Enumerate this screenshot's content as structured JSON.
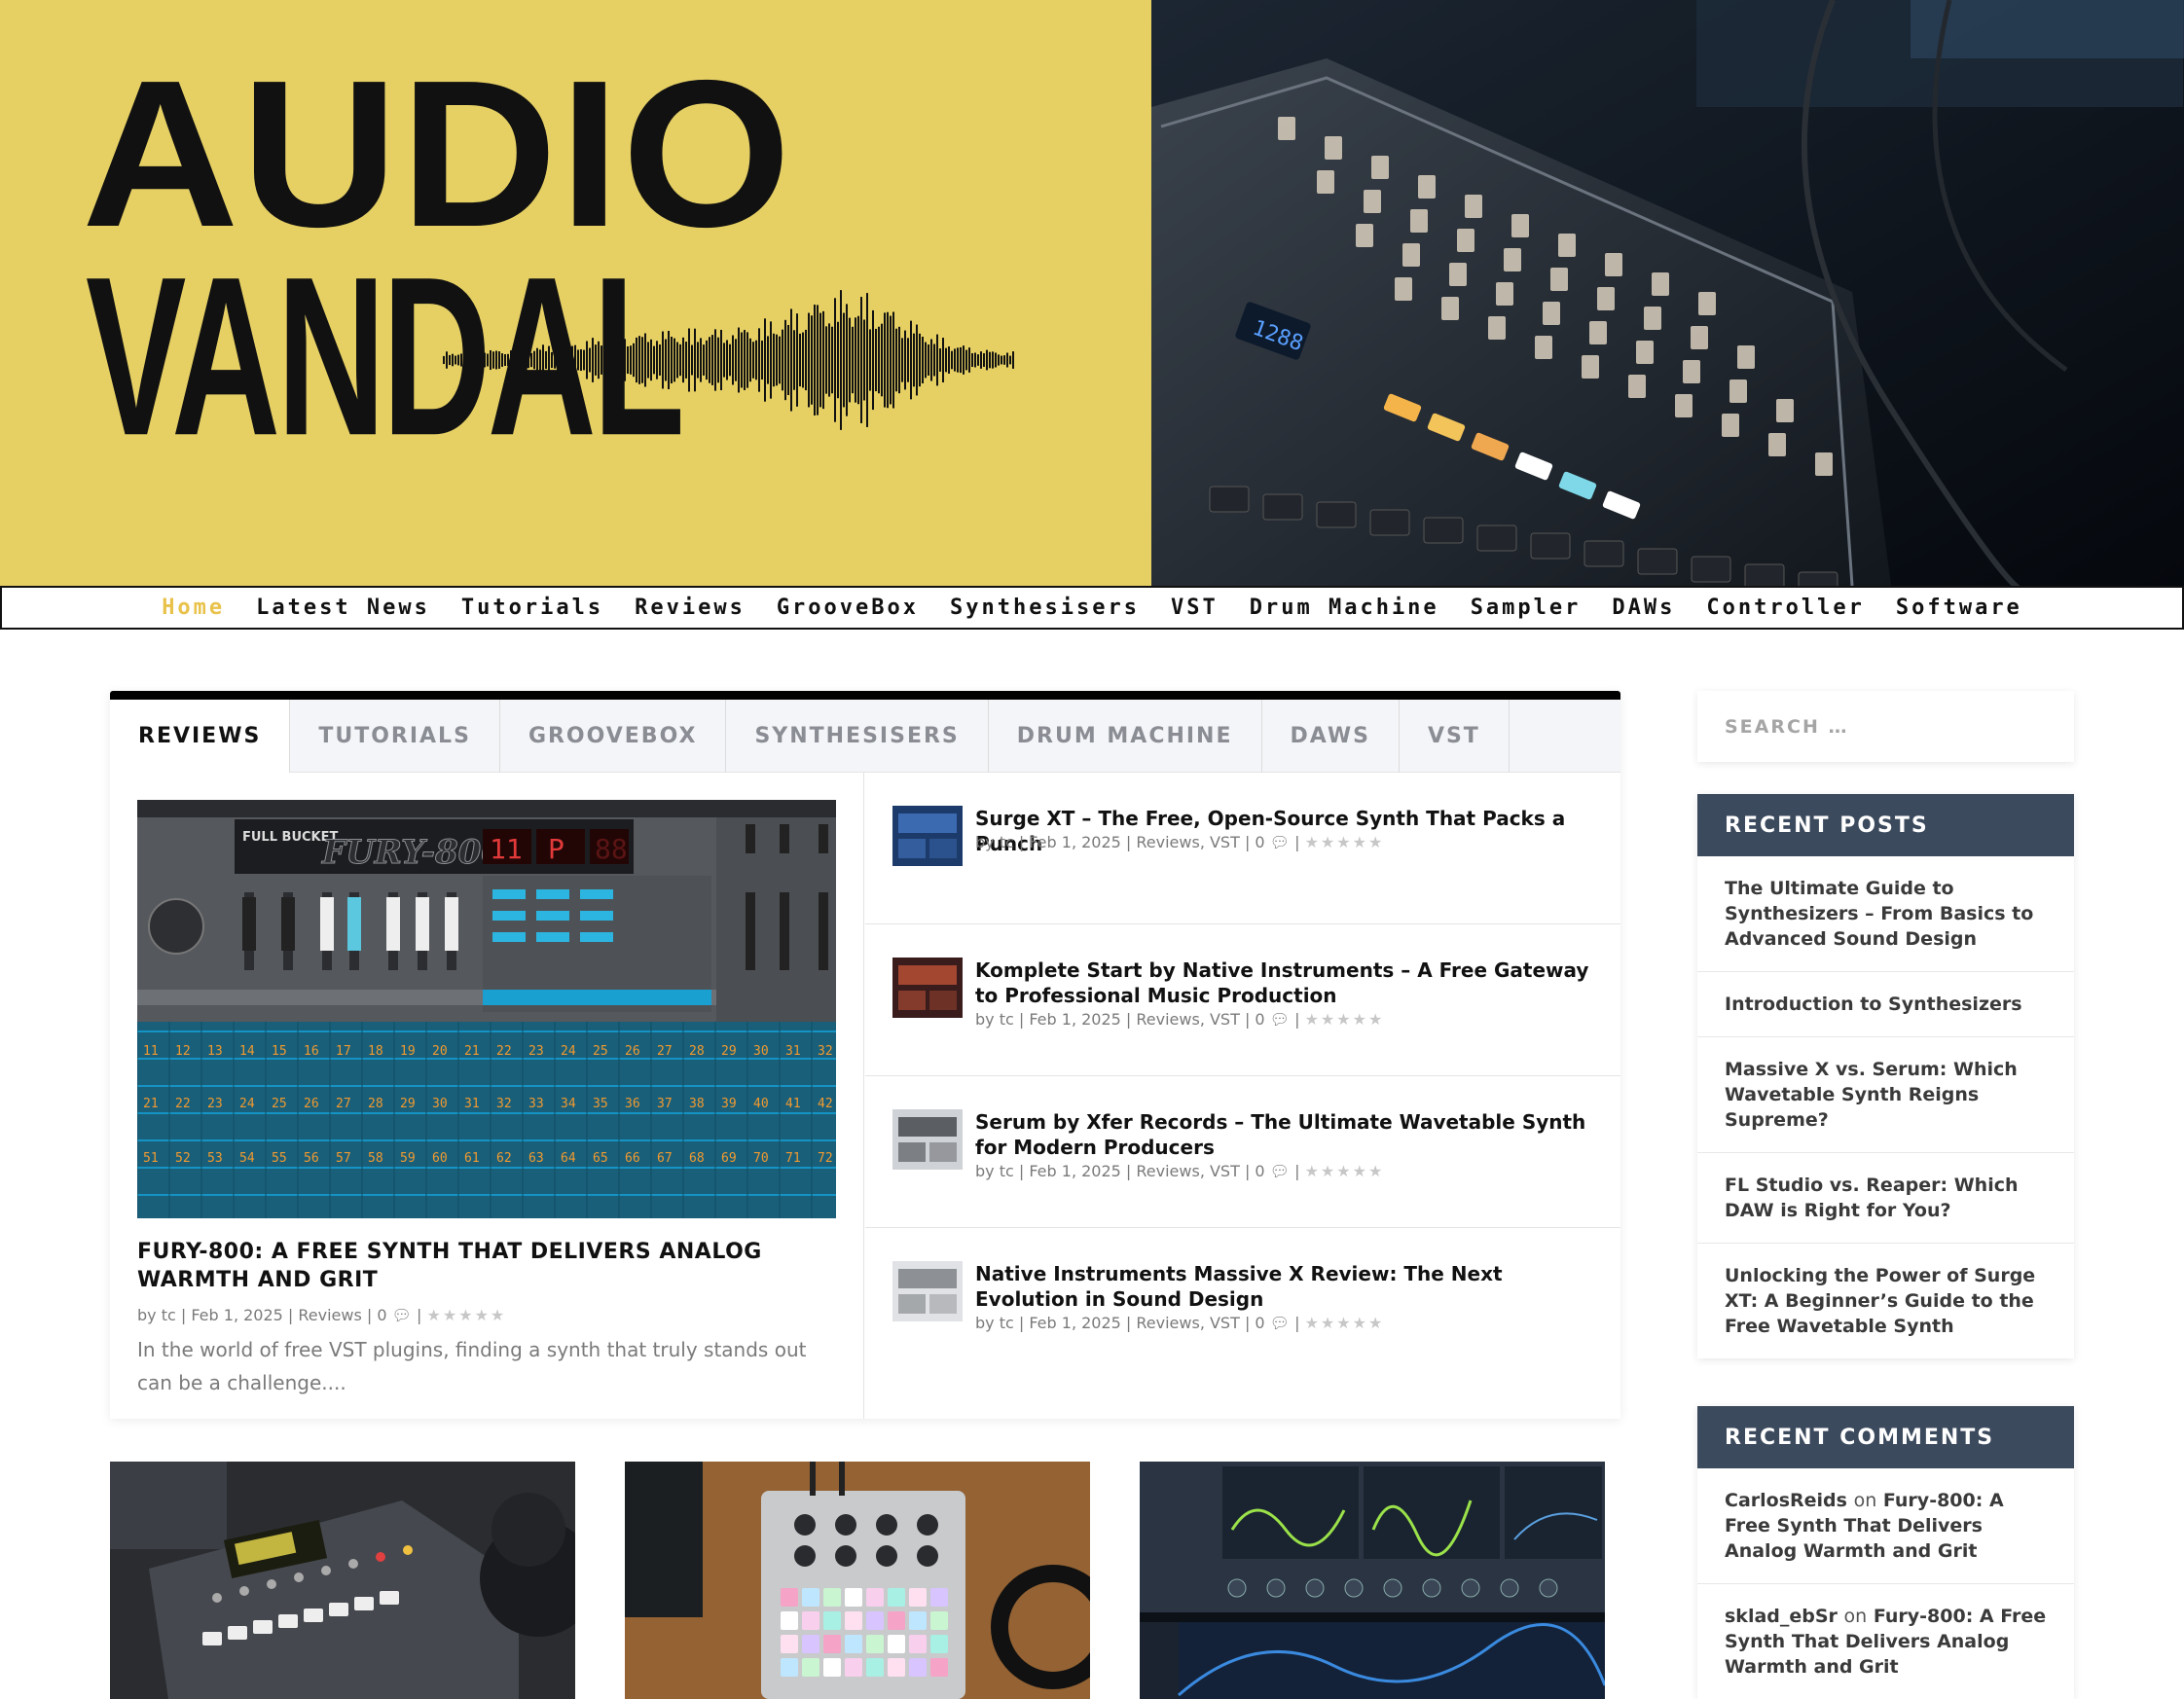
{
  "logo": {
    "line1": "AUDIO",
    "line2": "VANDAL"
  },
  "nav": {
    "items": [
      {
        "label": "Home",
        "active": true
      },
      {
        "label": "Latest News"
      },
      {
        "label": "Tutorials"
      },
      {
        "label": "Reviews"
      },
      {
        "label": "GrooveBox"
      },
      {
        "label": "Synthesisers"
      },
      {
        "label": "VST"
      },
      {
        "label": "Drum Machine"
      },
      {
        "label": "Sampler"
      },
      {
        "label": "DAWs"
      },
      {
        "label": "Controller"
      },
      {
        "label": "Software"
      }
    ]
  },
  "tabs": [
    "REVIEWS",
    "TUTORIALS",
    "GROOVEBOX",
    "SYNTHESISERS",
    "DRUM MACHINE",
    "DAWS",
    "VST"
  ],
  "feature": {
    "image_text": {
      "brand": "FULL BUCKET",
      "model": "FURY-800",
      "display1": "11",
      "display2": "P",
      "display3": "88"
    },
    "title": "FURY-800: A FREE SYNTH THAT DELIVERS ANALOG WARMTH AND GRIT",
    "meta": "by tc | Feb 1, 2025 | Reviews | 0",
    "stars": "★★★★★",
    "excerpt": "In the world of free VST plugins, finding a synth that truly stands out can be a challenge...."
  },
  "posts": [
    {
      "title": "Surge XT – The Free, Open-Source Synth That Packs a Punch",
      "meta": "by tc | Feb 1, 2025 | Reviews, VST | 0",
      "stars": "★★★★★"
    },
    {
      "title": "Komplete Start by Native Instruments – A Free Gateway to Professional Music Production",
      "meta": "by tc | Feb 1, 2025 | Reviews, VST | 0",
      "stars": "★★★★★"
    },
    {
      "title": "Serum by Xfer Records – The Ultimate Wavetable Synth for Modern Producers",
      "meta": "by tc | Feb 1, 2025 | Reviews, VST | 0",
      "stars": "★★★★★"
    },
    {
      "title": "Native Instruments Massive X Review: The Next Evolution in Sound Design",
      "meta": "by tc | Feb 1, 2025 | Reviews, VST | 0",
      "stars": "★★★★★"
    }
  ],
  "search": {
    "placeholder": "SEARCH …"
  },
  "recent_posts": {
    "heading": "RECENT POSTS",
    "items": [
      "The Ultimate Guide to Synthesizers – From Basics to Advanced Sound Design",
      "Introduction to Synthesizers",
      "Massive X vs. Serum: Which Wavetable Synth Reigns Supreme?",
      "FL Studio vs. Reaper: Which DAW is Right for You?",
      "Unlocking the Power of Surge XT: A Beginner’s Guide to the Free Wavetable Synth"
    ]
  },
  "recent_comments": {
    "heading": "RECENT COMMENTS",
    "connector": "on",
    "items": [
      {
        "author": "CarlosReids",
        "post": "Fury-800: A Free Synth That Delivers Analog Warmth and Grit"
      },
      {
        "author": "sklad_ebSr",
        "post": "Fury-800: A Free Synth That Delivers Analog Warmth and Grit"
      }
    ]
  },
  "colors": {
    "banner_yellow": "#e6d064",
    "nav_active": "#e8c24a",
    "widget_header": "#3c4a5e"
  }
}
